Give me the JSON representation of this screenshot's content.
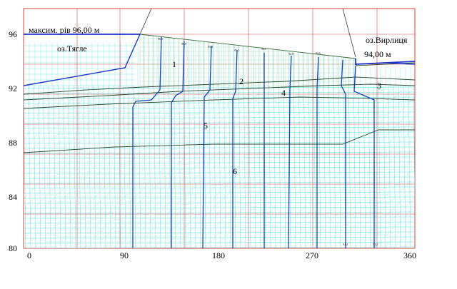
{
  "axes": {
    "y_ticks": [
      "96",
      "92",
      "88",
      "84",
      "80"
    ],
    "x_ticks": [
      "0",
      "90",
      "180",
      "270",
      "360"
    ]
  },
  "labels": {
    "max_level": "максим. рів 96,00 м",
    "lake_left": "оз.Тягле",
    "lake_right": "оз.Вирлиця",
    "level_right": "94,00 м"
  },
  "zones": [
    "1",
    "2",
    "3",
    "4",
    "5",
    "6"
  ],
  "probe_labels_top": [
    "96.0",
    "95.8",
    "95.4",
    "95.2",
    "95.0",
    "94.8",
    "94.6"
  ],
  "probe_labels_bottom": [
    "94.4",
    "94.2"
  ],
  "colors": {
    "mesh": "#33d6d6",
    "mesh_dam": "#9bd2a8",
    "grid_frame": "#d94040",
    "water": "#1a35c8",
    "flow_line": "#1440c0",
    "layer_line": "#2a4a30",
    "text": "#000000"
  }
}
